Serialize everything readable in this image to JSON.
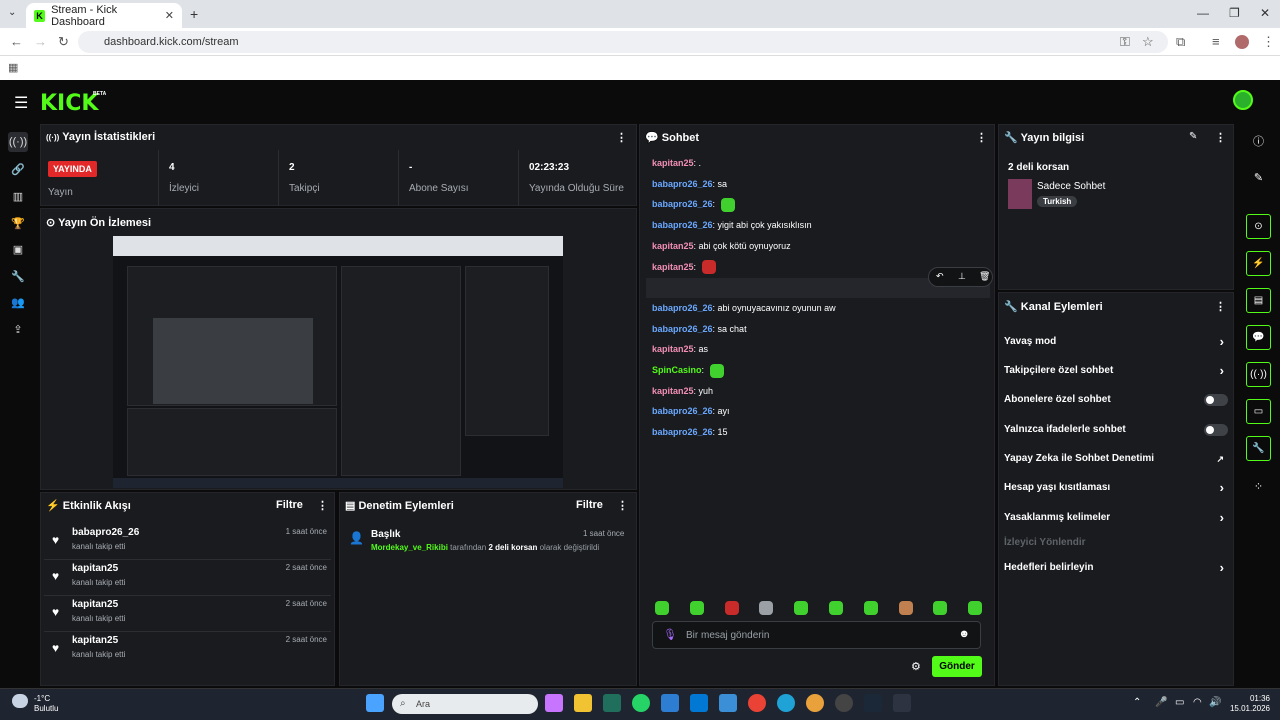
{
  "browser": {
    "tab_title": "Stream - Kick Dashboard",
    "url": "dashboard.kick.com/stream"
  },
  "header": {
    "logo": "KICK",
    "beta": "BETA"
  },
  "stats": {
    "title": "Yayın İstatistikleri",
    "live_badge": "YAYINDA",
    "live_label": "Yayın",
    "viewers_value": "4",
    "viewers_label": "İzleyici",
    "followers_value": "2",
    "followers_label": "Takipçi",
    "subs_value": "-",
    "subs_label": "Abone Sayısı",
    "duration_value": "02:23:23",
    "duration_label": "Yayında Olduğu Süre"
  },
  "preview": {
    "title": "Yayın Ön İzlemesi"
  },
  "activity": {
    "title": "Etkinlik Akışı",
    "filter": "Filtre",
    "items": [
      {
        "name": "babapro26_26",
        "sub": "kanalı takip etti",
        "time": "1 saat önce"
      },
      {
        "name": "kapitan25",
        "sub": "kanalı takip etti",
        "time": "2 saat önce"
      },
      {
        "name": "kapitan25",
        "sub": "kanalı takip etti",
        "time": "2 saat önce"
      },
      {
        "name": "kapitan25",
        "sub": "kanalı takip etti",
        "time": "2 saat önce"
      }
    ]
  },
  "moderation": {
    "title": "Denetim Eylemleri",
    "filter": "Filtre",
    "item_title": "Başlık",
    "item_time": "1 saat önce",
    "item_user": "Mordekay_ve_Rikibi",
    "item_mid": "tarafından",
    "item_value": "2 deli korsan",
    "item_end": "olarak değiştirildi"
  },
  "chat": {
    "title": "Sohbet",
    "messages": [
      {
        "user": "kapitan25",
        "color": "pink",
        "text": ".",
        "emote": ""
      },
      {
        "user": "babapro26_26",
        "color": "blue",
        "text": "sa",
        "emote": ""
      },
      {
        "user": "babapro26_26",
        "color": "blue",
        "text": "",
        "emote": "g"
      },
      {
        "user": "babapro26_26",
        "color": "blue",
        "text": "yigit abi çok yakısıklısın",
        "emote": ""
      },
      {
        "user": "kapitan25",
        "color": "pink",
        "text": "abi çok kötü oynuyoruz",
        "emote": ""
      },
      {
        "user": "kapitan25",
        "color": "pink",
        "text": "",
        "emote": "r"
      },
      {
        "user": "kapitan25",
        "color": "pink",
        "text": "",
        "emote": "r"
      },
      {
        "user": "babapro26_26",
        "color": "blue",
        "text": "abi oynuyacavınız oyunun aw",
        "emote": ""
      },
      {
        "user": "babapro26_26",
        "color": "blue",
        "text": "sa chat",
        "emote": ""
      },
      {
        "user": "kapitan25",
        "color": "pink",
        "text": "as",
        "emote": ""
      },
      {
        "user": "SpinCasino",
        "color": "green",
        "text": "",
        "emote": "g"
      },
      {
        "user": "kapitan25",
        "color": "pink",
        "text": "yuh",
        "emote": ""
      },
      {
        "user": "babapro26_26",
        "color": "blue",
        "text": "ayı",
        "emote": ""
      },
      {
        "user": "babapro26_26",
        "color": "blue",
        "text": "15",
        "emote": ""
      }
    ],
    "placeholder": "Bir mesaj gönderin",
    "send": "Gönder"
  },
  "stream_info": {
    "title": "Yayın bilgisi",
    "stream_title": "2 deli korsan",
    "category": "Sadece Sohbet",
    "tag": "Turkish"
  },
  "channel_actions": {
    "title": "Kanal Eylemleri",
    "items": [
      {
        "label": "Yavaş mod",
        "kind": "chevron"
      },
      {
        "label": "Takipçilere özel sohbet",
        "kind": "chevron"
      },
      {
        "label": "Abonelere özel sohbet",
        "kind": "toggle"
      },
      {
        "label": "Yalnızca ifadelerle sohbet",
        "kind": "toggle"
      },
      {
        "label": "Yapay Zeka ile Sohbet Denetimi",
        "kind": "external"
      },
      {
        "label": "Hesap yaşı kısıtlaması",
        "kind": "chevron"
      },
      {
        "label": "Yasaklanmış kelimeler",
        "kind": "chevron"
      },
      {
        "label": "İzleyici Yönlendir",
        "kind": "disabled"
      },
      {
        "label": "Hedefleri belirleyin",
        "kind": "chevron"
      }
    ]
  },
  "taskbar": {
    "weather_temp": "-1°C",
    "weather_desc": "Bulutlu",
    "search": "Ara",
    "time": "01:36",
    "date": "15.01.2026"
  },
  "colors": {
    "accent": "#53fc18",
    "live": "#e22828",
    "panel": "#191b1f"
  }
}
